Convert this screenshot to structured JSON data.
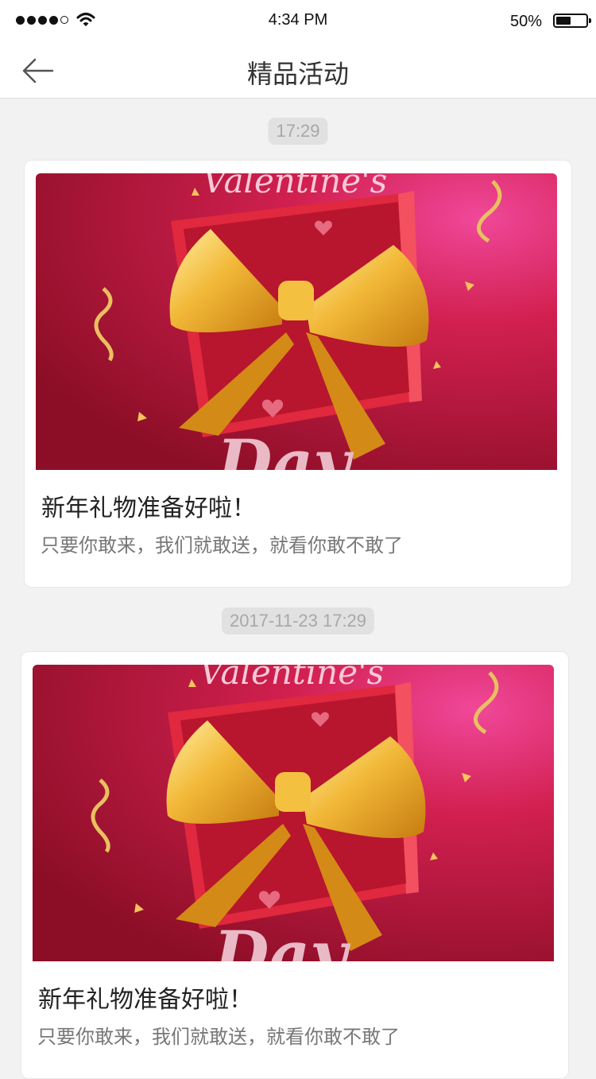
{
  "status_bar": {
    "time": "4:34 PM",
    "battery_percent": "50%",
    "battery_level": 0.5,
    "signal_bars": 4,
    "icons": [
      "signal-dots-icon",
      "wifi-icon",
      "battery-icon"
    ]
  },
  "nav": {
    "title": "精品活动",
    "back_icon": "arrow-left-icon"
  },
  "colors": {
    "background": "#f2f2f2",
    "banner_red": "#c21a3c",
    "ribbon_gold": "#e6a21c"
  },
  "messages": [
    {
      "timestamp": "17:29",
      "banner_text_top": "Valentine's",
      "banner_text_bottom": "Day",
      "title": "新年礼物准备好啦！",
      "description": "只要你敢来，我们就敢送，就看你敢不敢了"
    },
    {
      "timestamp": "2017-11-23 17:29",
      "banner_text_top": "Valentine's",
      "banner_text_bottom": "Day",
      "title": "新年礼物准备好啦！",
      "description": "只要你敢来，我们就敢送，就看你敢不敢了"
    }
  ]
}
